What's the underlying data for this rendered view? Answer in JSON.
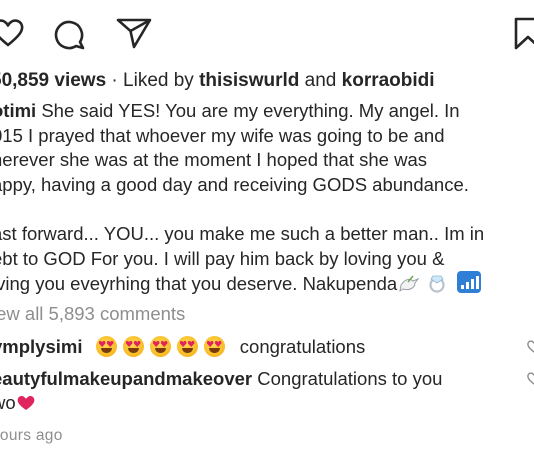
{
  "post": {
    "views_count": "50,859 views",
    "liked_by_prefix": " · Liked by ",
    "liked_by_user1": "thisiswurld",
    "liked_by_and": " and ",
    "liked_by_user2": "korraobidi"
  },
  "caption": {
    "username": "otimi",
    "lines": [
      " She said YES! You are my everything. My angel. In",
      "015 I prayed that whoever my wife was going to be and",
      "herever she was at the moment I hoped that she was",
      "appy, having a good day and receiving GODS abundance.",
      "ast forward... YOU... you make me such a better man.. Im in",
      "ebt to GOD For you. I will pay him back by loving you &",
      "iving you eveyrhing that you deserve. Nakupenda"
    ]
  },
  "comments_link": "iew all 5,893 comments",
  "comments": [
    {
      "username": "ymplysimi",
      "text": "congratulations",
      "emoji": "heart-eyes-face",
      "emoji_count": 5
    },
    {
      "username": "eautyfulmakeupandmakeover",
      "text_line1": " Congratulations to you",
      "text_line2": "wo"
    }
  ],
  "timestamp": "hours ago",
  "icons": [
    "heart-icon",
    "comment-icon",
    "send-icon",
    "bookmark-icon",
    "dove-emoji",
    "ring-emoji",
    "signal-emoji",
    "red-heart-emoji"
  ],
  "colors": {
    "text": "#262626",
    "muted": "#8e8e8e",
    "heart": "#e0245e",
    "emoji": "#f7b924"
  }
}
